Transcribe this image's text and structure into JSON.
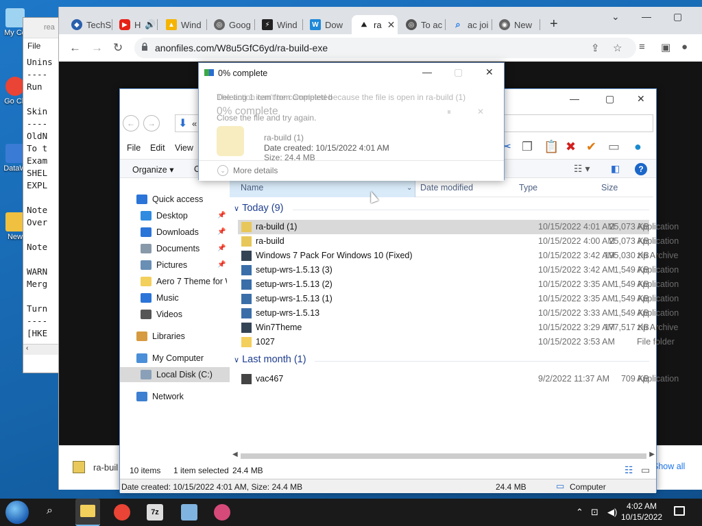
{
  "desktop": {
    "icons": [
      {
        "label": "My Co",
        "color": "#9fd3f2"
      },
      {
        "label": "Go Ch",
        "color": "#e94435"
      },
      {
        "label": "DataW",
        "color": "#3a7bd5"
      },
      {
        "label": "New",
        "color": "#f0c040"
      }
    ]
  },
  "notepad": {
    "title": "rea",
    "menu": "File",
    "lines": "Unins\n----\nRun\n\nSkin\n----\nOldN\nTo t\nExam\nSHEL\nEXPL\n\nNote\nOver\n\nNote\n\nWARN\nMerg\n\nTurn\n----\n[HKE"
  },
  "browser": {
    "tabs": [
      {
        "label": "TechS",
        "icon": "techspot-icon",
        "color": "#2b5fad"
      },
      {
        "label": "H",
        "icon": "youtube-icon",
        "color": "#e62117"
      },
      {
        "label": "Wind",
        "icon": "google-drive-icon",
        "color": "#f5b400"
      },
      {
        "label": "Goog",
        "icon": "globe-icon",
        "color": "#666666"
      },
      {
        "label": "Wind",
        "icon": "lightning-icon",
        "color": "#222222"
      },
      {
        "label": "Dow",
        "icon": "w-logo-icon",
        "color": "#1e88d8"
      },
      {
        "label": "ra",
        "icon": "anonfiles-icon",
        "color": "#333333",
        "active": true
      },
      {
        "label": "To ac",
        "icon": "globe-icon",
        "color": "#555555"
      },
      {
        "label": "ac joi",
        "icon": "search-icon",
        "color": "#1a73e8"
      },
      {
        "label": "New",
        "icon": "chrome-icon",
        "color": "#666666"
      }
    ],
    "url": "anonfiles.com/W8u5GfC6yd/ra-build-exe",
    "download": {
      "name": "ra-buil",
      "show_all": "Show all"
    }
  },
  "explorer": {
    "breadcrumb": "«",
    "menu": [
      "File",
      "Edit",
      "View"
    ],
    "organize": "Organize ▾",
    "organize_more": "O",
    "columns": {
      "name": "Name",
      "date": "Date modified",
      "type": "Type",
      "size": "Size"
    },
    "nav": [
      {
        "label": "Quick access",
        "color": "#2b74d8"
      },
      {
        "label": "Desktop",
        "color": "#2f8be0",
        "pinned": true
      },
      {
        "label": "Downloads",
        "color": "#2b74d8",
        "pinned": true
      },
      {
        "label": "Documents",
        "color": "#8899aa",
        "pinned": true
      },
      {
        "label": "Pictures",
        "color": "#6a8fb5",
        "pinned": true
      },
      {
        "label": "Aero 7 Theme for W",
        "color": "#f3cf5c"
      },
      {
        "label": "Music",
        "color": "#2b74d8"
      },
      {
        "label": "Videos",
        "color": "#555555"
      },
      {
        "label": "Libraries",
        "color": "#d69a40"
      },
      {
        "label": "My Computer",
        "color": "#4a8fd8"
      },
      {
        "label": "Local Disk (C:)",
        "color": "#8aa0b8",
        "selected": true
      },
      {
        "label": "Network",
        "color": "#3d7fd0"
      }
    ],
    "groups": [
      {
        "label": "Today (9)",
        "files": [
          {
            "name": "ra-build (1)",
            "date": "10/15/2022 4:01 AM",
            "type": "Application",
            "size": "25,073 KB",
            "color": "#e8c75a",
            "selected": true
          },
          {
            "name": "ra-build",
            "date": "10/15/2022 4:00 AM",
            "type": "Application",
            "size": "25,073 KB",
            "color": "#e8c75a"
          },
          {
            "name": "Windows 7 Pack For Windows 10 (Fixed)",
            "date": "10/15/2022 3:42 AM",
            "type": "zip Archive",
            "size": "195,030 KB",
            "color": "#334455"
          },
          {
            "name": "setup-wrs-1.5.13 (3)",
            "date": "10/15/2022 3:42 AM",
            "type": "Application",
            "size": "1,549 KB",
            "color": "#3a6ea8"
          },
          {
            "name": "setup-wrs-1.5.13 (2)",
            "date": "10/15/2022 3:35 AM",
            "type": "Application",
            "size": "1,549 KB",
            "color": "#3a6ea8"
          },
          {
            "name": "setup-wrs-1.5.13 (1)",
            "date": "10/15/2022 3:35 AM",
            "type": "Application",
            "size": "1,549 KB",
            "color": "#3a6ea8"
          },
          {
            "name": "setup-wrs-1.5.13",
            "date": "10/15/2022 3:33 AM",
            "type": "Application",
            "size": "1,549 KB",
            "color": "#3a6ea8"
          },
          {
            "name": "Win7Theme",
            "date": "10/15/2022 3:29 AM",
            "type": "zip Archive",
            "size": "177,517 KB",
            "color": "#334455"
          },
          {
            "name": "1027",
            "date": "10/15/2022 3:53 AM",
            "type": "File folder",
            "size": "",
            "color": "#f3cf5c"
          }
        ]
      },
      {
        "label": "Last month (1)",
        "files": [
          {
            "name": "vac467",
            "date": "9/2/2022 11:37 AM",
            "type": "Application",
            "size": "709 KB",
            "color": "#444444"
          }
        ]
      }
    ],
    "status": {
      "count": "10 items",
      "selected": "1 item selected",
      "size": "24.4 MB"
    },
    "details": {
      "info": "Date created: 10/15/2022 4:01 AM, Size: 24.4 MB",
      "size": "24.4 MB",
      "location": "Computer"
    }
  },
  "dialog": {
    "title": "0% complete",
    "ghost_line1": "Deleting 1 item from Completed",
    "ghost_line1b": "The action can't be completed because the file is open in ra-build (1)",
    "ghost_percent": "0% complete",
    "ghost_line2": "Close the file and try again.",
    "file_name": "ra-build (1)",
    "file_created": "Date created: 10/15/2022 4:01 AM",
    "file_size": "Size: 24.4 MB",
    "more_details": "More details"
  },
  "taskbar": {
    "time": "4:02 AM",
    "date": "10/15/2022",
    "items": [
      {
        "name": "search-icon",
        "color": "#1a1a1a"
      },
      {
        "name": "file-explorer-icon",
        "color": "#f3cf5c"
      },
      {
        "name": "chrome-icon",
        "color": "#e94435"
      },
      {
        "name": "7zip-icon",
        "color": "#dddddd"
      },
      {
        "name": "notepad-icon",
        "color": "#7fb3e0"
      },
      {
        "name": "app-icon",
        "color": "#d64a7a"
      }
    ]
  }
}
